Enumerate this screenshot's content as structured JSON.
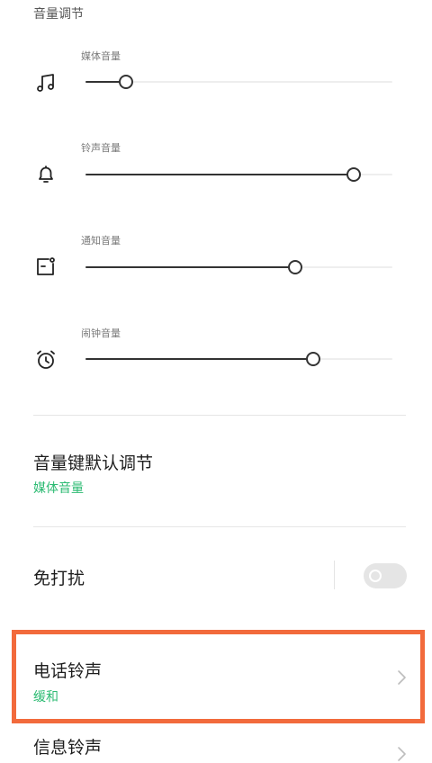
{
  "section": {
    "title": "音量调节"
  },
  "volumes": [
    {
      "label": "媒体音量",
      "icon": "music-note-icon",
      "level_percent": 13
    },
    {
      "label": "铃声音量",
      "icon": "bell-icon",
      "level_percent": 87
    },
    {
      "label": "通知音量",
      "icon": "notification-icon",
      "level_percent": 68
    },
    {
      "label": "闹钟音量",
      "icon": "alarm-clock-icon",
      "level_percent": 74
    }
  ],
  "volume_key": {
    "title": "音量键默认调节",
    "value": "媒体音量"
  },
  "dnd": {
    "title": "免打扰",
    "enabled": false
  },
  "ringtone": {
    "title": "电话铃声",
    "value": "缓和"
  },
  "message_tone": {
    "title": "信息铃声"
  },
  "colors": {
    "accent_green": "#2dbb73",
    "highlight": "#f26a3c"
  }
}
